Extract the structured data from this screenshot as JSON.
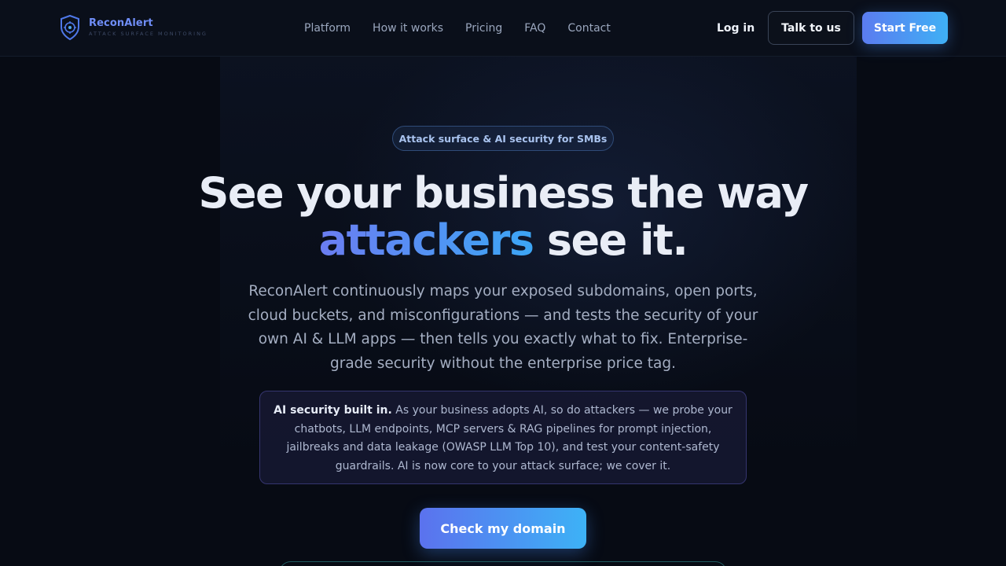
{
  "brand": {
    "name": "ReconAlert",
    "tagline": "ATTACK SURFACE MONITORING",
    "logo_icon": "shield-target-icon"
  },
  "nav": {
    "items": [
      {
        "label": "Platform"
      },
      {
        "label": "How it works"
      },
      {
        "label": "Pricing"
      },
      {
        "label": "FAQ"
      },
      {
        "label": "Contact"
      }
    ]
  },
  "header_actions": {
    "login": "Log in",
    "talk": "Talk to us",
    "start": "Start Free"
  },
  "hero": {
    "pill": "Attack surface & AI security for SMBs",
    "title_line1": "See your business the way",
    "title_highlight": "attackers",
    "title_end": " see it.",
    "lead": "ReconAlert continuously maps your exposed subdomains, open ports, cloud buckets, and misconfigurations — and tests the security of your own AI & LLM apps — then tells you exactly what to fix. Enterprise-grade security without the enterprise price tag.",
    "ai_box_bold": "AI security built in.",
    "ai_box_text": " As your business adopts AI, so do attackers — we probe your chatbots, LLM endpoints, MCP servers & RAG pipelines for prompt injection, jailbreaks and data leakage (OWASP LLM Top 10), and test your content-safety guardrails. AI is now core to your attack surface; we cover it.",
    "cta": "Check my domain"
  },
  "colors": {
    "accent_start": "#5b7cf0",
    "accent_end": "#3fb0f5",
    "background": "#070b14"
  }
}
